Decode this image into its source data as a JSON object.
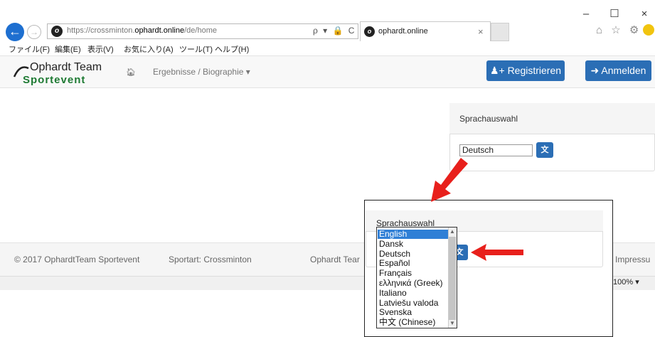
{
  "browser": {
    "url_prefix": "https://crossminton.",
    "url_host": "ophardt.online",
    "url_path": "/de/home",
    "addr_tools": "ρ ▾ 🔒 C",
    "tab_title": "ophardt.online",
    "tab_close": "×",
    "right_icons": "⌂ ☆ ⚙",
    "win_min": "–",
    "win_max": "☐",
    "win_close": "×",
    "zoom": "100%  ▾"
  },
  "menubar": {
    "items": [
      "ファイル(F)",
      "編集(E)",
      "表示(V)",
      "お気に入り(A)",
      "ツール(T)",
      "ヘルプ(H)"
    ]
  },
  "site": {
    "logo_top": "Ophardt Team",
    "logo_bottom": "Sportevent",
    "nav_results": "Ergebnisse / Biographie ▾",
    "register": "Registrieren",
    "login": "Anmelden"
  },
  "language_panel": {
    "title": "Sprachauswahl",
    "selected": "Deutsch"
  },
  "callout": {
    "title": "Sprachauswahl",
    "options": [
      "English",
      "Dansk",
      "Deutsch",
      "Español",
      "Français",
      "ελληνικά (Greek)",
      "Italiano",
      "Latviešu valoda",
      "Svenska",
      "中文 (Chinese)"
    ],
    "highlighted": "English"
  },
  "footer": {
    "copyright": "© 2017 OphardtTeam Sportevent",
    "sport": "Sportart: Crossminton",
    "team": "Ophardt Tear",
    "impressum": "Impressu"
  },
  "colors": {
    "primary": "#2b6eb5",
    "arrow": "#e8201c",
    "logo_green": "#1e7a33"
  }
}
